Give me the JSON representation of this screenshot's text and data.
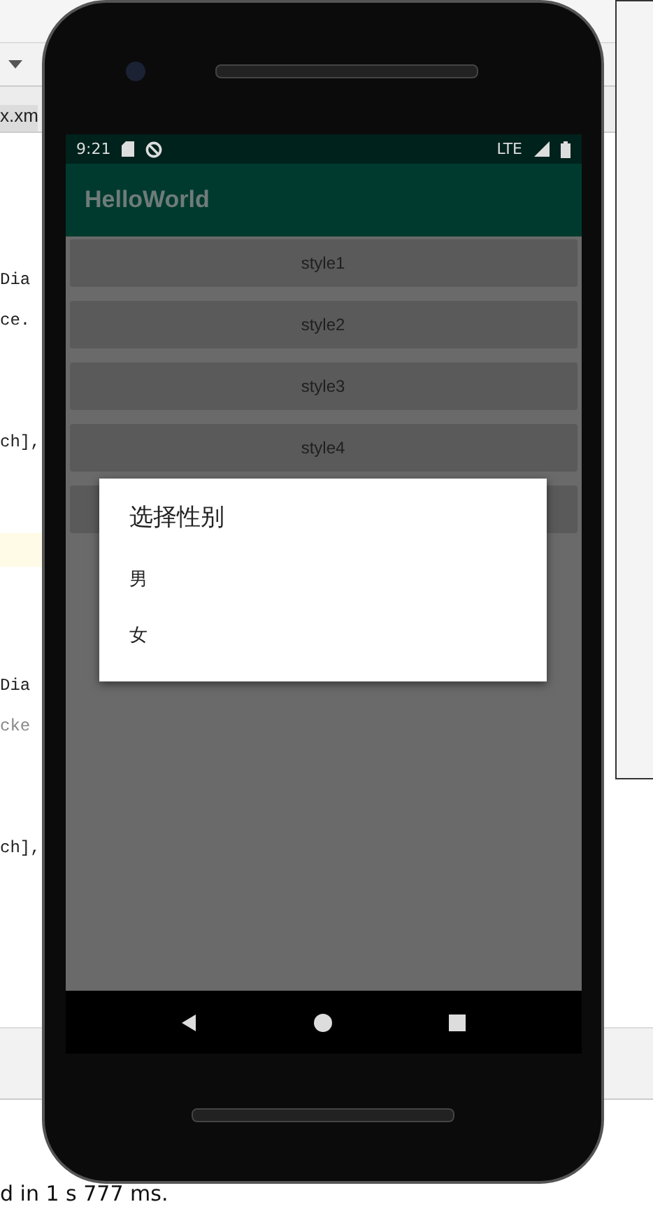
{
  "ide": {
    "tab": "x.xm",
    "code_lines": [
      "Dia",
      "ce.",
      "ch],",
      "Dia",
      "cke",
      "ch],"
    ],
    "build_output": "d in 1 s 777 ms."
  },
  "phone": {
    "status_bar": {
      "time": "9:21",
      "network": "LTE"
    },
    "app_bar": {
      "title": "HelloWorld"
    },
    "buttons": [
      "style1",
      "style2",
      "style3",
      "style4"
    ],
    "dialog": {
      "title": "选择性别",
      "items": [
        "男",
        "女"
      ]
    }
  }
}
